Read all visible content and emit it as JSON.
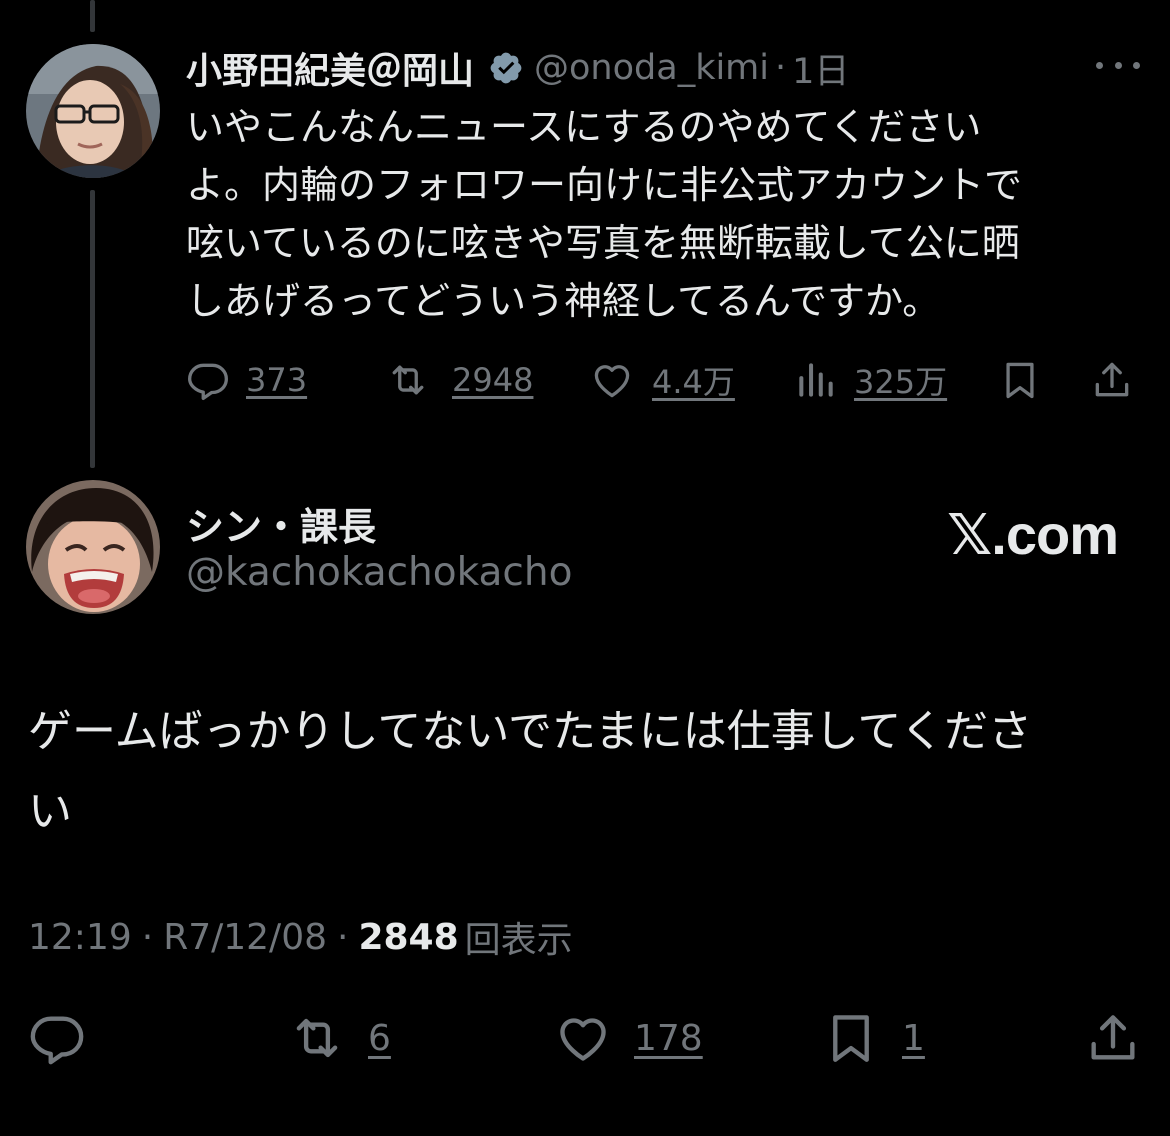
{
  "quoted_tweet": {
    "display_name": "小野田紀美＠岡山",
    "handle": "@onoda_kimi",
    "separator": "·",
    "time": "1日",
    "text": "いやこんなんニュースにするのやめてください\nよ。内輪のフォロワー向けに非公式アカウントで\n呟いているのに呟きや写真を無断転載して公に晒\nしあげるってどういう神経してるんですか。",
    "stats": {
      "replies": "373",
      "reposts": "2948",
      "likes": "4.4万",
      "views": "325万"
    },
    "icons": {
      "verified": "verified-badge-icon",
      "more": "more-icon",
      "reply": "reply-icon",
      "repost": "repost-icon",
      "like": "heart-icon",
      "views": "views-chart-icon",
      "bookmark": "bookmark-icon",
      "share": "share-icon"
    }
  },
  "main_tweet": {
    "display_name": "シン・課長",
    "handle": "@kachokachokacho",
    "brand": "𝕏.com",
    "text": "ゲームばっかりしてないでたまには仕事してくださ\nい",
    "time": "12:19",
    "sep1": "·",
    "date": "R7/12/08",
    "sep2": "·",
    "views": "2848",
    "views_label": "回表示",
    "actions": {
      "reposts": "6",
      "likes": "178",
      "bookmarks": "1"
    }
  },
  "colors": {
    "background": "#000000",
    "text": "#e7e9ea",
    "muted": "#71767b",
    "thread_line": "#333639",
    "verified": "#829aab"
  }
}
